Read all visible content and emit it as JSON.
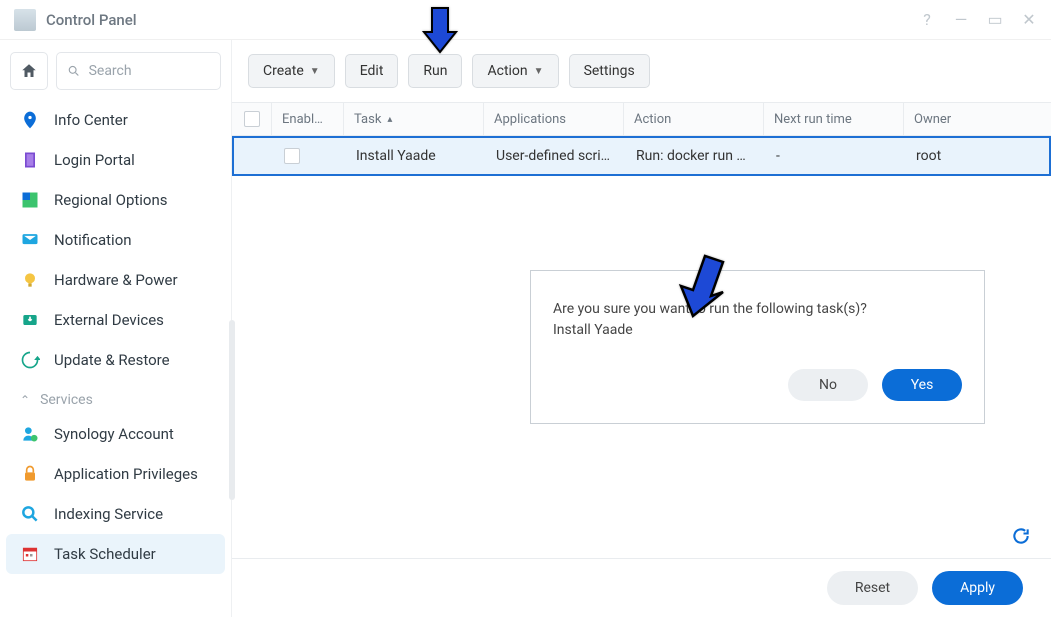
{
  "window": {
    "title": "Control Panel"
  },
  "search": {
    "placeholder": "Search"
  },
  "sidebar": {
    "items": [
      {
        "label": "Info Center"
      },
      {
        "label": "Login Portal"
      },
      {
        "label": "Regional Options"
      },
      {
        "label": "Notification"
      },
      {
        "label": "Hardware & Power"
      },
      {
        "label": "External Devices"
      },
      {
        "label": "Update & Restore"
      }
    ],
    "section": "Services",
    "services": [
      {
        "label": "Synology Account"
      },
      {
        "label": "Application Privileges"
      },
      {
        "label": "Indexing Service"
      },
      {
        "label": "Task Scheduler"
      }
    ]
  },
  "toolbar": {
    "create": "Create",
    "edit": "Edit",
    "run": "Run",
    "action": "Action",
    "settings": "Settings"
  },
  "columns": {
    "enabled": "Enabl…",
    "task": "Task",
    "applications": "Applications",
    "action": "Action",
    "next": "Next run time",
    "owner": "Owner"
  },
  "row": {
    "task": "Install Yaade",
    "applications": "User-defined scri…",
    "action": "Run: docker run …",
    "next": "-",
    "owner": "root"
  },
  "dialog": {
    "line1": "Are you sure you want to run the following task(s)?",
    "line2": "Install Yaade",
    "no": "No",
    "yes": "Yes"
  },
  "footer": {
    "reset": "Reset",
    "apply": "Apply"
  }
}
